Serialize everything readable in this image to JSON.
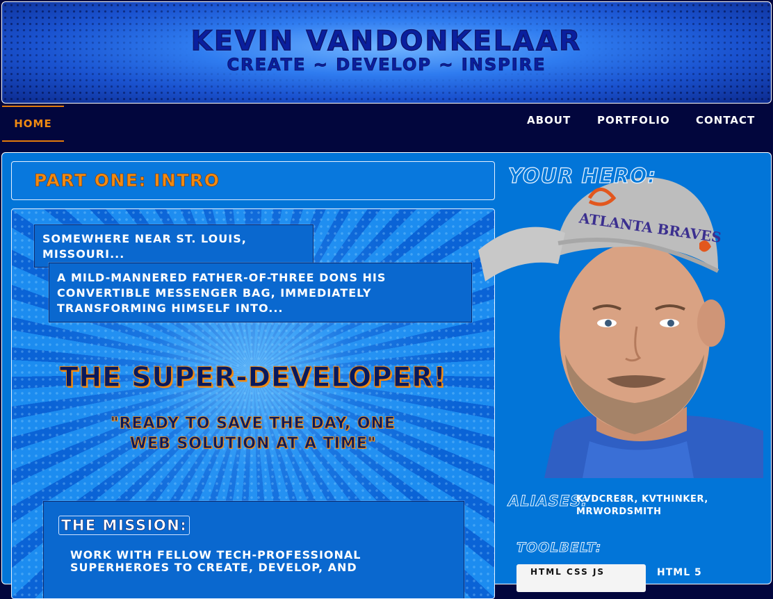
{
  "header": {
    "title": "Kevin VanDonkelaar",
    "tagline": "Create ~ Develop ~ Inspire"
  },
  "nav": {
    "home": "Home",
    "about": "About",
    "portfolio": "Portfolio",
    "contact": "Contact",
    "active": "Home"
  },
  "section": {
    "part_title": "Part One: Intro"
  },
  "comic": {
    "caption_location": "Somewhere near St. Louis, Missouri...",
    "caption_story": "A mild-mannered father-of-three dons his convertible messenger bag, immediately transforming himself into...",
    "hero_name": "The Super-Developer!",
    "hero_quote": "\"Ready to save the day, one web solution at a time\"",
    "mission_title": "The Mission:",
    "mission_text": "Work with fellow tech-professional superheroes to create, develop, and"
  },
  "sidebar": {
    "hero_heading": "Your Hero:",
    "photo_alt": "Portrait photo",
    "aliases_label": "Aliases:",
    "aliases_text": "KVDcre8r, KVThinker, MrWordsmith",
    "toolbelt_label": "Toolbelt:",
    "tool_badge_text": "HTML CSS JS",
    "tool_first": "HTML 5"
  },
  "colors": {
    "background": "#02063d",
    "panel": "#0275d8",
    "accent": "#f08a12",
    "title_navy": "#0a1f9e"
  },
  "icons": {
    "photo": "person-portrait"
  }
}
